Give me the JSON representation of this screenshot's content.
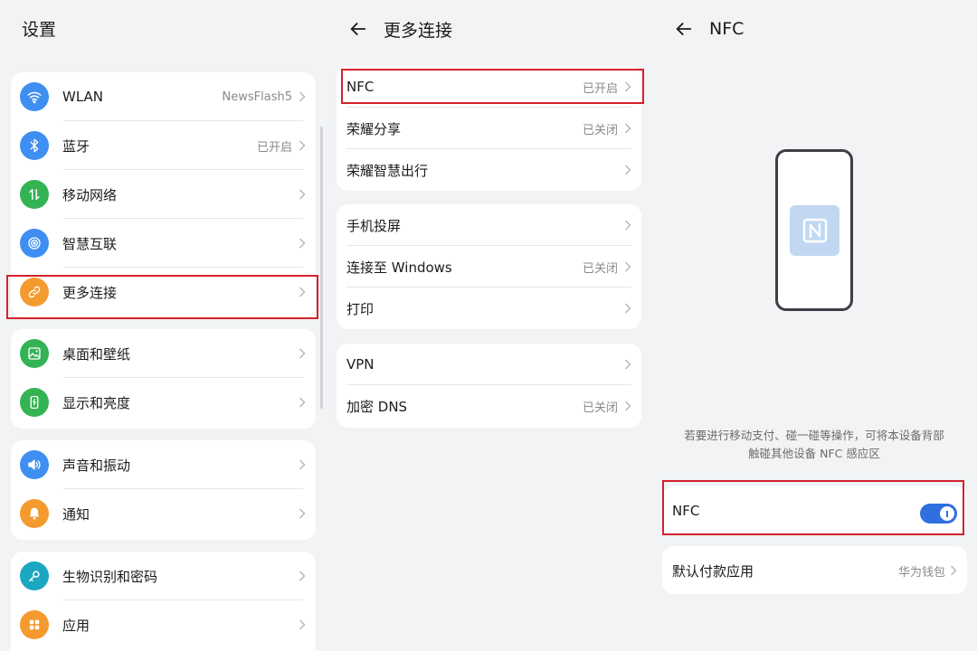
{
  "settings": {
    "title": "设置",
    "groups": [
      {
        "items": [
          {
            "label": "WLAN",
            "value": "NewsFlash5",
            "icon": "wifi-icon",
            "color": "#3f8ef2"
          },
          {
            "label": "蓝牙",
            "value": "已开启",
            "icon": "bluetooth-icon",
            "color": "#3f8ef2"
          },
          {
            "label": "移动网络",
            "value": "",
            "icon": "mobile-data-icon",
            "color": "#34b354"
          },
          {
            "label": "智慧互联",
            "value": "",
            "icon": "smart-connect-icon",
            "color": "#3f8ef2"
          },
          {
            "label": "更多连接",
            "value": "",
            "icon": "link-icon",
            "color": "#f49a2e"
          }
        ]
      },
      {
        "items": [
          {
            "label": "桌面和壁纸",
            "value": "",
            "icon": "wallpaper-icon",
            "color": "#34b354"
          },
          {
            "label": "显示和亮度",
            "value": "",
            "icon": "display-icon",
            "color": "#34b354"
          }
        ]
      },
      {
        "items": [
          {
            "label": "声音和振动",
            "value": "",
            "icon": "sound-icon",
            "color": "#3f8ef2"
          },
          {
            "label": "通知",
            "value": "",
            "icon": "bell-icon",
            "color": "#f49a2e"
          }
        ]
      },
      {
        "items": [
          {
            "label": "生物识别和密码",
            "value": "",
            "icon": "key-icon",
            "color": "#1aa7bf"
          },
          {
            "label": "应用",
            "value": "",
            "icon": "apps-icon",
            "color": "#f49a2e"
          }
        ]
      }
    ]
  },
  "more_connections": {
    "title": "更多连接",
    "groups": [
      {
        "items": [
          {
            "label": "NFC",
            "value": "已开启"
          },
          {
            "label": "荣耀分享",
            "value": "已关闭"
          },
          {
            "label": "荣耀智慧出行",
            "value": ""
          }
        ]
      },
      {
        "items": [
          {
            "label": "手机投屏",
            "value": ""
          },
          {
            "label": "连接至 Windows",
            "value": "已关闭"
          },
          {
            "label": "打印",
            "value": ""
          }
        ]
      },
      {
        "items": [
          {
            "label": "VPN",
            "value": ""
          },
          {
            "label": "加密 DNS",
            "value": "已关闭"
          }
        ]
      }
    ]
  },
  "nfc": {
    "title": "NFC",
    "description_line1": "若要进行移动支付、碰一碰等操作，可将本设备背部",
    "description_line2": "触碰其他设备 NFC 感应区",
    "toggle_label": "NFC",
    "toggle_on": true,
    "default_payment_label": "默认付款应用",
    "default_payment_value": "华为钱包"
  },
  "colors": {
    "highlight": "#d3222a",
    "accent": "#2f6fde",
    "background": "#f1f3f5"
  }
}
